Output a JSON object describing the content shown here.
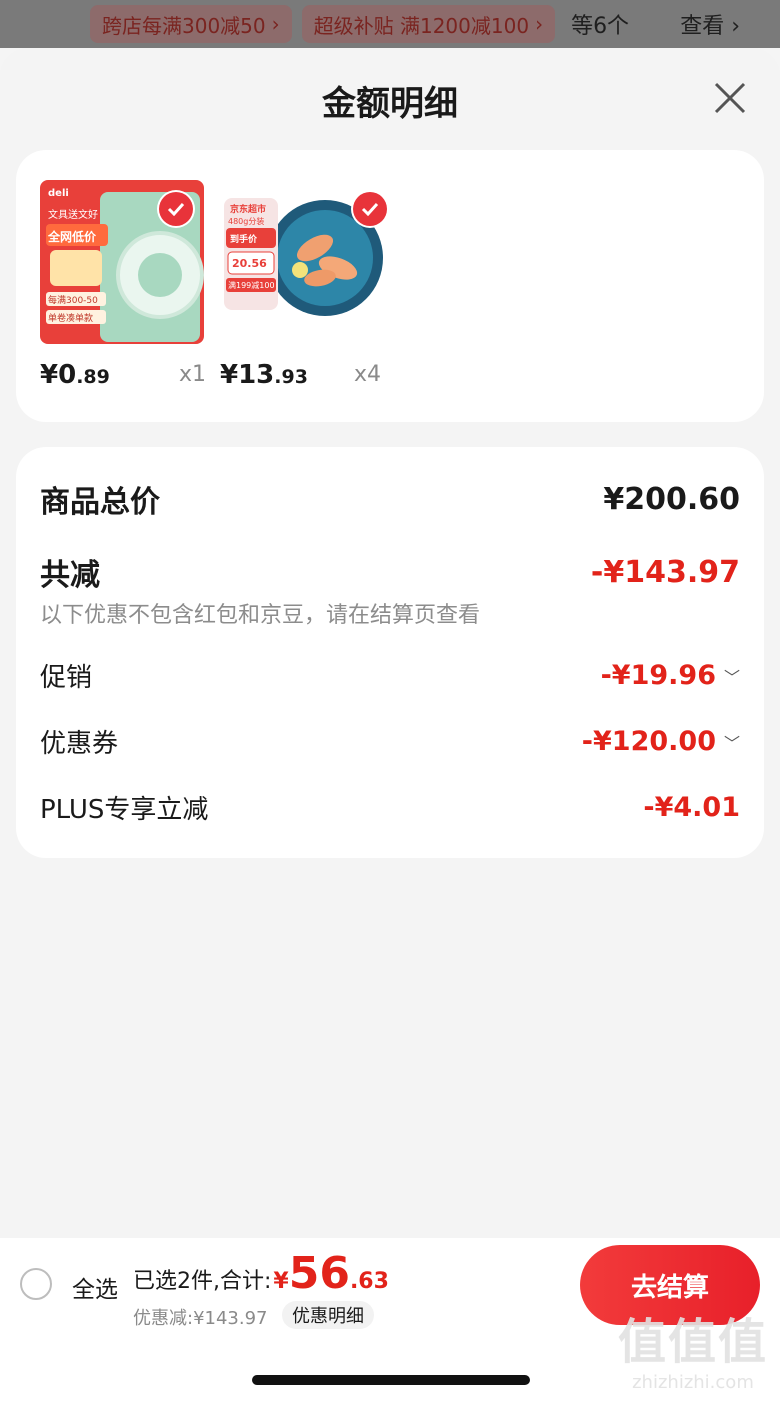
{
  "promo_strip": {
    "tag1": "跨店每满300减50",
    "tag2": "超级补贴 满1200减100",
    "more": "等6个",
    "view": "查看"
  },
  "sheet": {
    "title": "金额明细"
  },
  "products": [
    {
      "brand": "deli",
      "badge1": "文具送文好",
      "badge2": "全网低价",
      "badge3": "每满300-50",
      "badge4": "单卷凑单款",
      "price_int": "¥0",
      "price_dec": ".89",
      "qty": "x1"
    },
    {
      "brand": "京东超市",
      "badge1": "480g分装",
      "badge2": "到手价",
      "badge3": "20.56",
      "badge4": "满199减100",
      "price_int": "¥13",
      "price_dec": ".93",
      "qty": "x4"
    }
  ],
  "summary": {
    "total_label": "商品总价",
    "total_value": "¥200.60",
    "discount_label": "共减",
    "discount_value": "-¥143.97",
    "note": "以下优惠不包含红包和京豆，请在结算页查看",
    "promo_label": "促销",
    "promo_value": "-¥19.96",
    "coupon_label": "优惠券",
    "coupon_value": "-¥120.00",
    "plus_label": "PLUS专享立减",
    "plus_value": "-¥4.01"
  },
  "bottom": {
    "select_all": "全选",
    "selected_text": "已选2件,合计:",
    "currency": "¥",
    "total_int": "56",
    "total_dec": ".63",
    "saved": "优惠减:¥143.97",
    "detail": "优惠明细",
    "checkout": "去结算"
  },
  "watermark": {
    "big": "值值值",
    "small": "zhizhizhi.com"
  },
  "colors": {
    "accent_red": "#e2231a",
    "check_red": "#e8333a"
  }
}
